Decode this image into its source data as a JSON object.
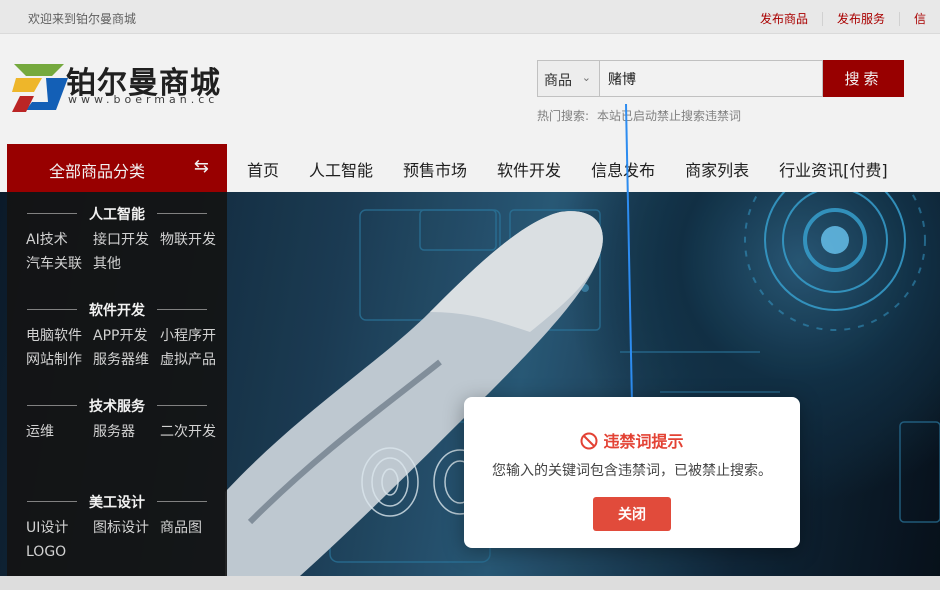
{
  "topbar": {
    "welcome": "欢迎来到铂尔曼商城",
    "links": [
      "发布商品",
      "发布服务",
      "信"
    ]
  },
  "header": {
    "logo_text": "铂尔曼商城",
    "logo_url": "www.boerman.cc",
    "search": {
      "category": "商品",
      "value": "赌博",
      "button": "搜索",
      "hot_label": "热门搜索:",
      "hot_text": "本站已启动禁止搜索违禁词"
    }
  },
  "nav": {
    "all_categories": "全部商品分类",
    "items": [
      "首页",
      "人工智能",
      "预售市场",
      "软件开发",
      "信息发布",
      "商家列表",
      "行业资讯[付费]"
    ]
  },
  "categories": [
    {
      "title": "人工智能",
      "items": [
        "AI技术",
        "接口开发",
        "物联开发",
        "汽车关联",
        "其他"
      ]
    },
    {
      "title": "软件开发",
      "items": [
        "电脑软件",
        "APP开发",
        "小程序开",
        "网站制作",
        "服务器维",
        "虚拟产品"
      ]
    },
    {
      "title": "技术服务",
      "items": [
        "运维",
        "服务器",
        "二次开发"
      ]
    },
    {
      "title": "美工设计",
      "items": [
        "UI设计",
        "图标设计",
        "商品图",
        "LOGO"
      ]
    }
  ],
  "modal": {
    "title": "违禁词提示",
    "message": "您输入的关键词包含违禁词，已被禁止搜索。",
    "close": "关闭"
  },
  "colors": {
    "brand_red": "#a10000",
    "modal_red": "#e14b3b",
    "annotation_arrow": "#2d8cf0"
  }
}
